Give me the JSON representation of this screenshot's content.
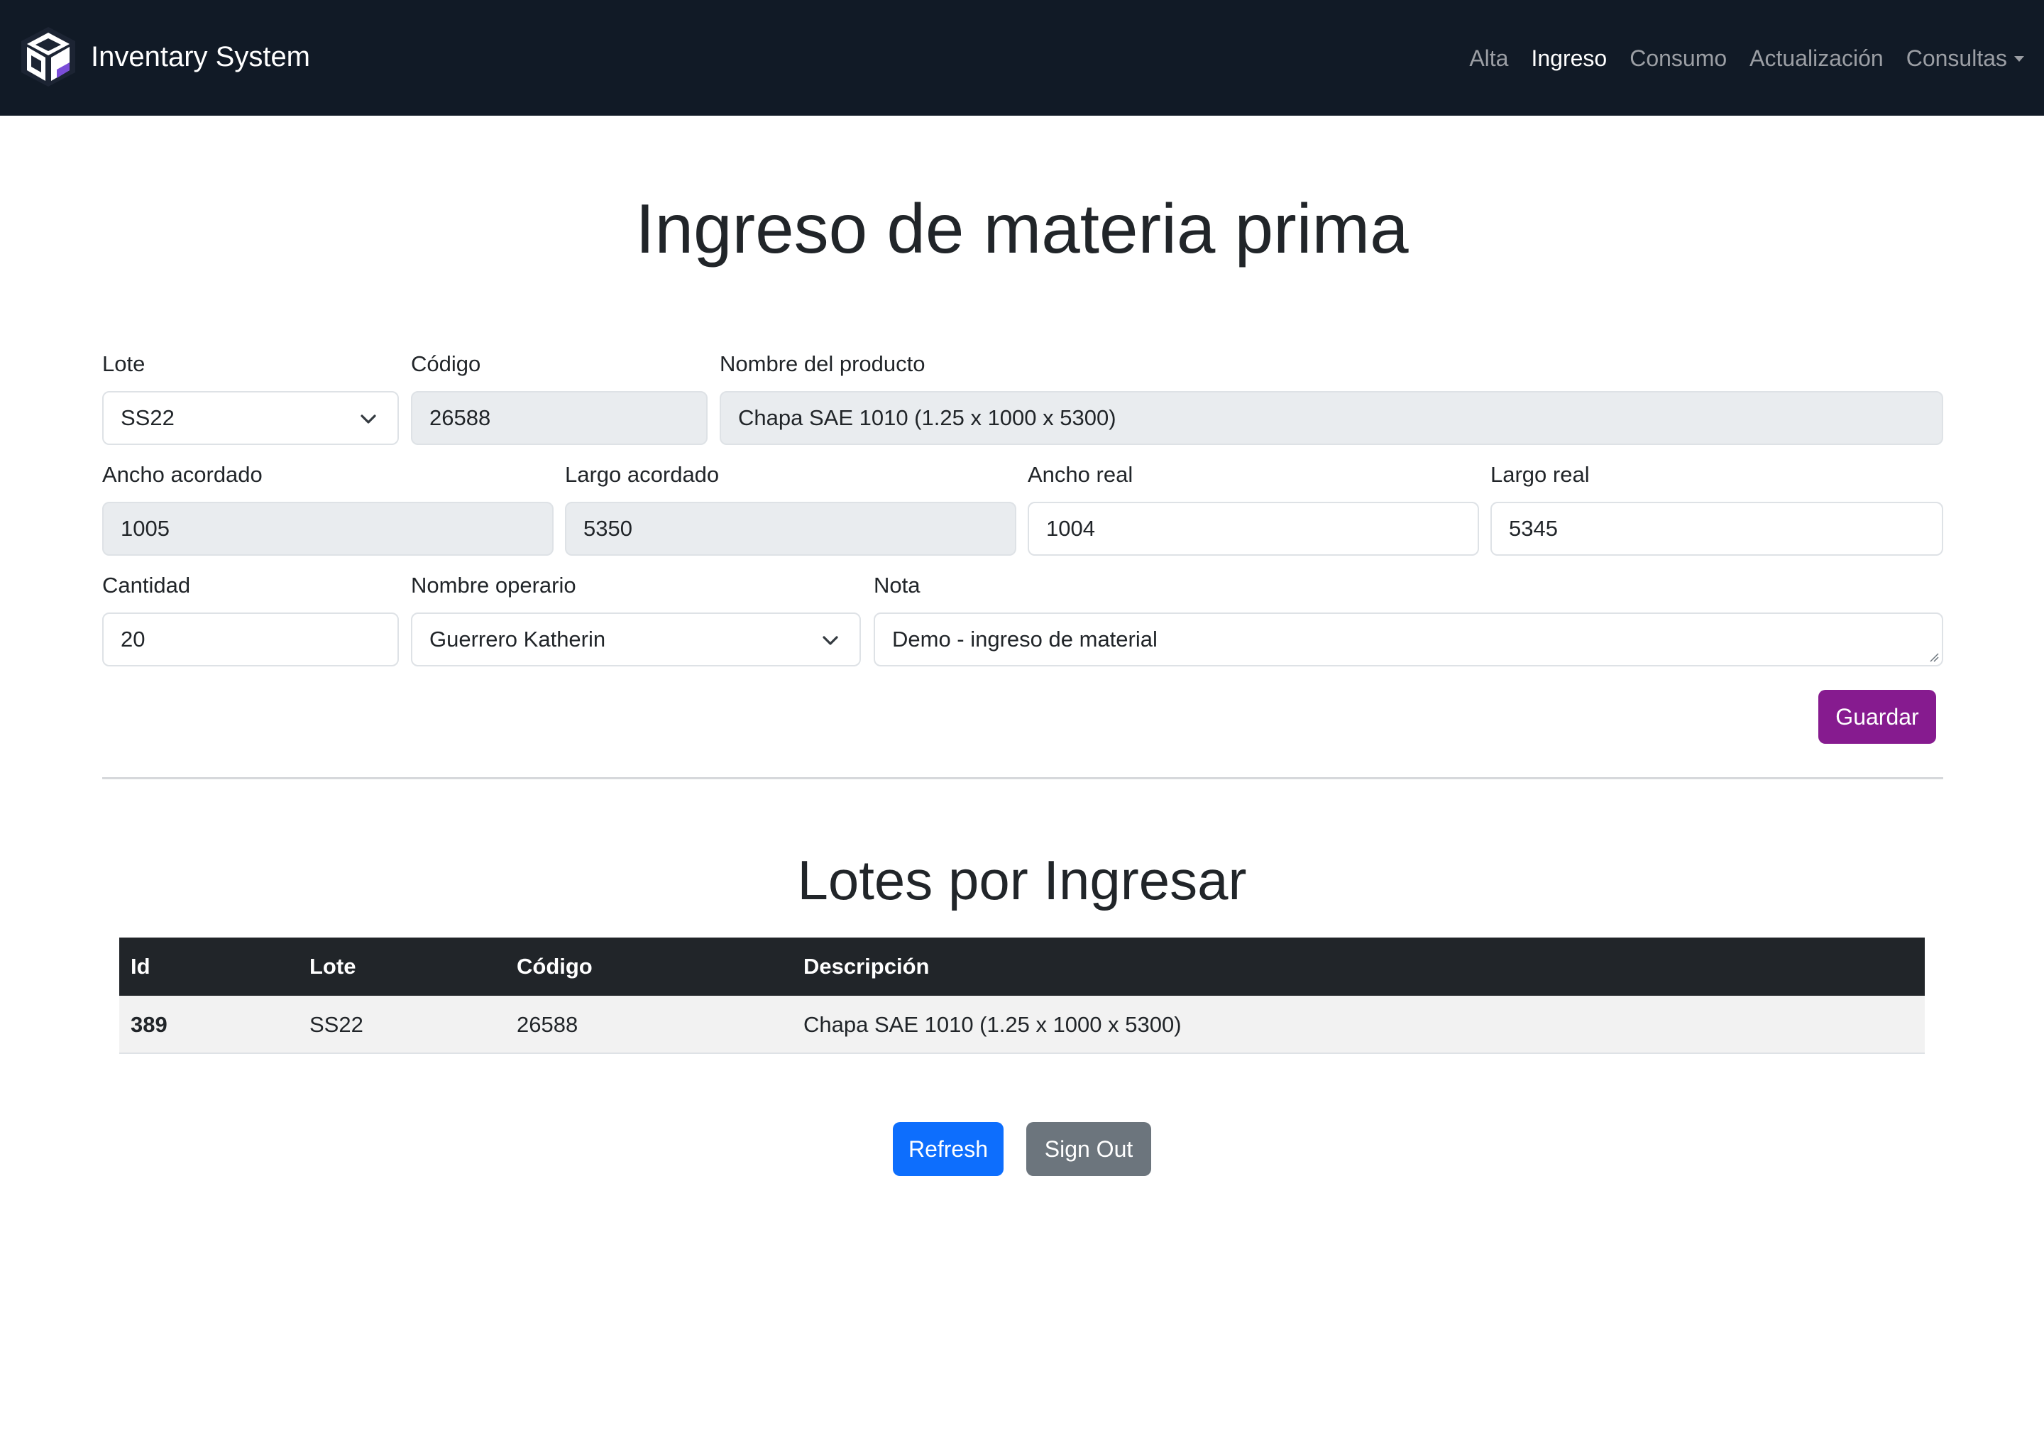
{
  "navbar": {
    "brand": "Inventary System",
    "links": [
      {
        "label": "Alta"
      },
      {
        "label": "Ingreso"
      },
      {
        "label": "Consumo"
      },
      {
        "label": "Actualización"
      },
      {
        "label": "Consultas"
      }
    ],
    "active": "Ingreso"
  },
  "page_title": "Ingreso de materia prima",
  "form": {
    "lote": {
      "label": "Lote",
      "value": "SS22"
    },
    "codigo": {
      "label": "Código",
      "value": "26588"
    },
    "nombre_producto": {
      "label": "Nombre del producto",
      "value": "Chapa SAE 1010 (1.25 x 1000 x 5300)"
    },
    "ancho_acordado": {
      "label": "Ancho acordado",
      "value": "1005"
    },
    "largo_acordado": {
      "label": "Largo acordado",
      "value": "5350"
    },
    "ancho_real": {
      "label": "Ancho real",
      "value": "1004"
    },
    "largo_real": {
      "label": "Largo real",
      "value": "5345"
    },
    "cantidad": {
      "label": "Cantidad",
      "value": "20"
    },
    "nombre_operario": {
      "label": "Nombre operario",
      "value": "Guerrero Katherin"
    },
    "nota": {
      "label": "Nota",
      "value": "Demo - ingreso de material"
    },
    "save_label": "Guardar"
  },
  "lotes": {
    "title": "Lotes por Ingresar",
    "headers": [
      "Id",
      "Lote",
      "Código",
      "Descripción"
    ],
    "rows": [
      [
        "389",
        "SS22",
        "26588",
        "Chapa SAE 1010 (1.25 x 1000 x 5300)"
      ]
    ]
  },
  "actions": {
    "refresh_label": "Refresh",
    "signout_label": "Sign Out"
  },
  "colors": {
    "navbar_bg": "#111a26",
    "guardar": "#861b8f",
    "refresh": "#0d6efd",
    "signout": "#6c757d",
    "table_header": "#212529"
  }
}
